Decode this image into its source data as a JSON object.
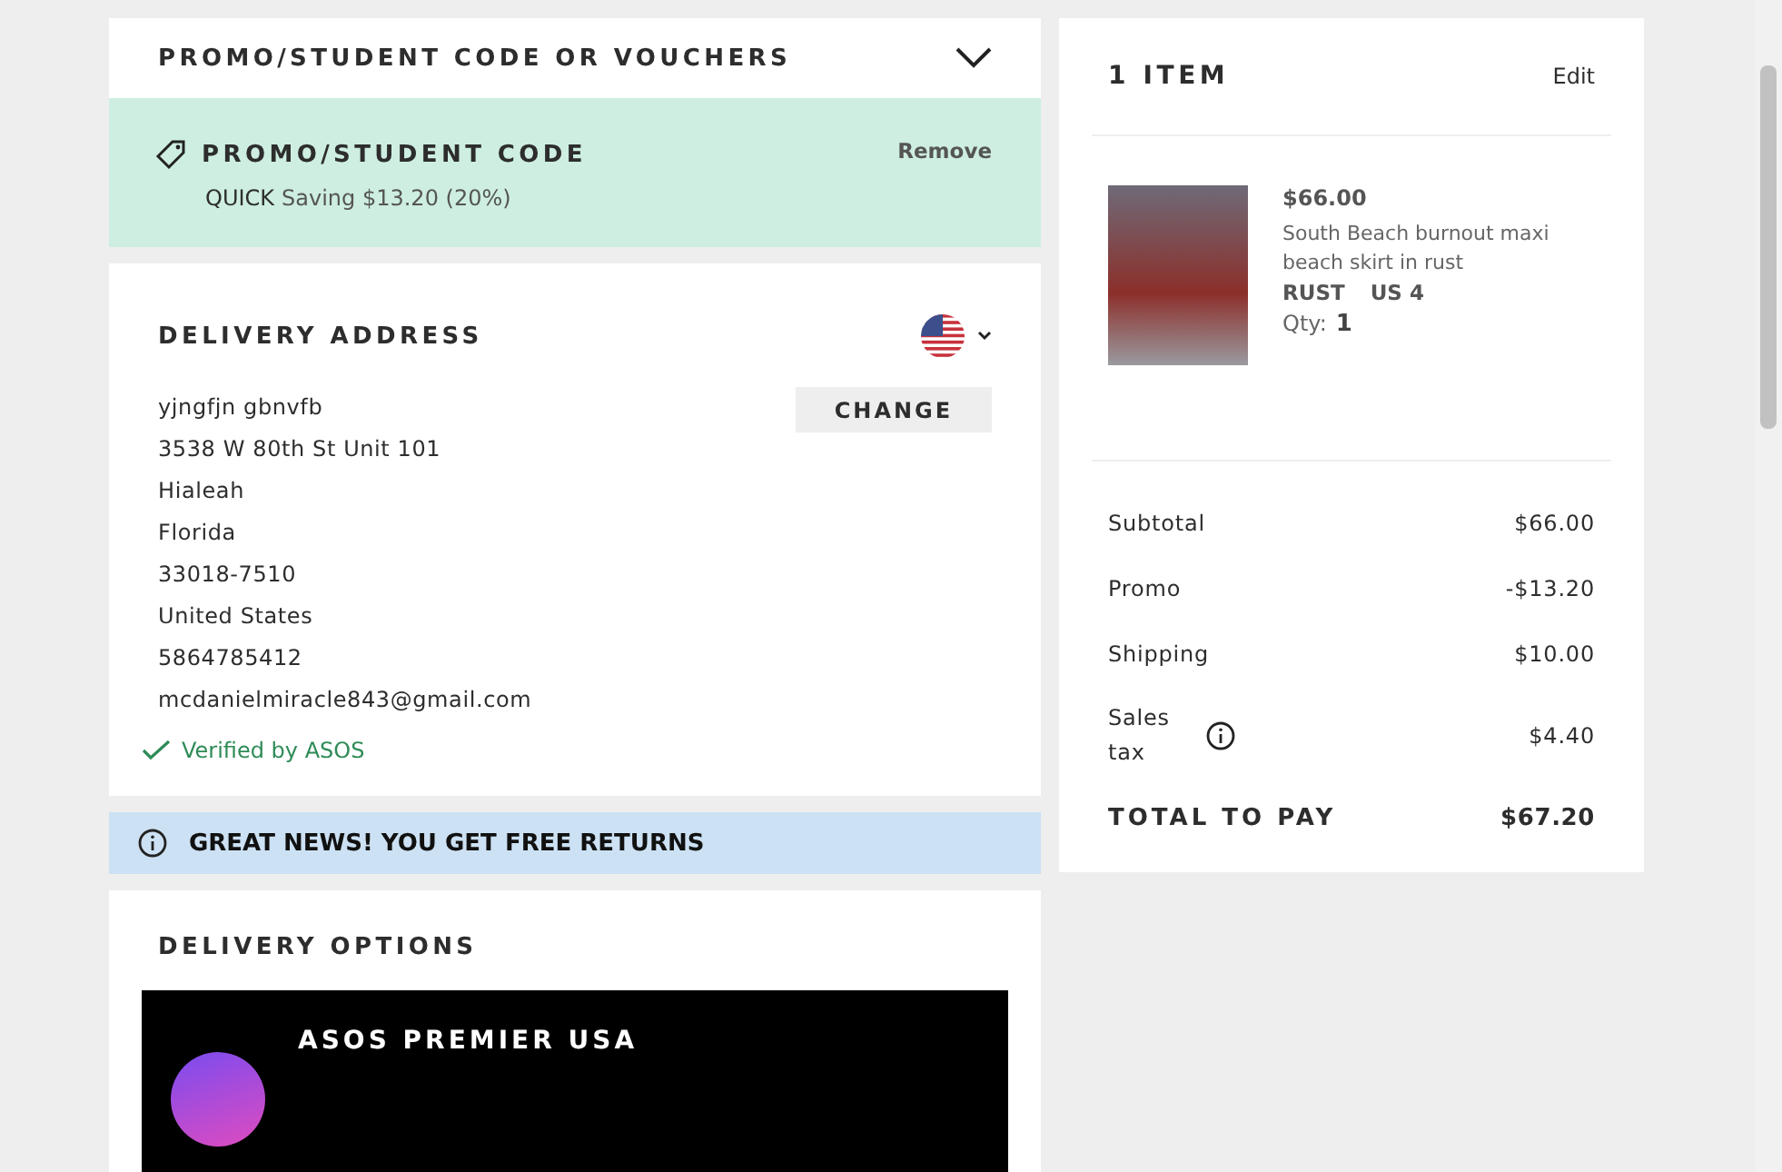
{
  "promo_section": {
    "title": "PROMO/STUDENT CODE OR VOUCHERS",
    "expanded": false
  },
  "applied_promo": {
    "title": "PROMO/STUDENT CODE",
    "code": "QUICK",
    "saving": "Saving $13.20 (20%)",
    "remove": "Remove"
  },
  "delivery_address": {
    "title": "DELIVERY ADDRESS",
    "change": "CHANGE",
    "lines": [
      "yjngfjn gbnvfb",
      "3538 W 80th St Unit 101",
      "Hialeah",
      "Florida",
      "33018-7510",
      "United States",
      "5864785412",
      "mcdanielmiracle843@gmail.com"
    ],
    "verified": "Verified by ASOS"
  },
  "returns_banner": "GREAT NEWS! YOU GET FREE RETURNS",
  "delivery_options": {
    "title": "DELIVERY OPTIONS",
    "premier": {
      "title": "ASOS PREMIER USA"
    }
  },
  "bag": {
    "title": "1 ITEM",
    "edit": "Edit",
    "items": [
      {
        "price": "$66.00",
        "name": "South Beach burnout maxi beach skirt in rust",
        "colour": "RUST",
        "size": "US 4",
        "qty_label": "Qty:",
        "qty": "1"
      }
    ]
  },
  "totals": [
    {
      "label": "Subtotal",
      "value": "$66.00",
      "kind": "plain"
    },
    {
      "label": "Promo",
      "value": "-$13.20",
      "kind": "plain"
    },
    {
      "label": "Shipping",
      "value": "$10.00",
      "kind": "plain"
    },
    {
      "label": "Sales tax",
      "value": "$4.40",
      "kind": "info"
    },
    {
      "label": "TOTAL TO PAY",
      "value": "$67.20",
      "kind": "total"
    }
  ]
}
